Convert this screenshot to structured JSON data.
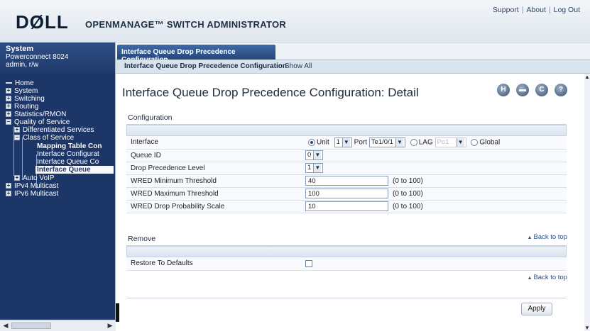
{
  "header": {
    "logo": "DØLL",
    "app_title": "OPENMANAGE™ SWITCH ADMINISTRATOR",
    "links": [
      "Support",
      "About",
      "Log Out"
    ]
  },
  "system_box": {
    "title": "System",
    "model": "Powerconnect 8024",
    "user": "admin, r/w"
  },
  "nav": {
    "home": "Home",
    "system": "System",
    "switching": "Switching",
    "routing": "Routing",
    "statistics": "Statistics/RMON",
    "qos": "Quality of Service",
    "diffserv": "Differentiated Services",
    "cos": "Class of Service",
    "mapping_table": "Mapping Table Con",
    "interface_config": "Interface Configurat",
    "interface_queue_co": "Interface Queue Co",
    "interface_queue_sel": "Interface Queue",
    "auto_voip": "Auto VoIP",
    "ipv4_mc": "IPv4 Multicast",
    "ipv6_mc": "IPv6 Multicast"
  },
  "tabs": {
    "active": "Interface Queue Drop Precedence Configuration",
    "sub1": "Interface Queue Drop Precedence Configuration",
    "sub2": "Show All"
  },
  "page": {
    "title": "Interface Queue Drop Precedence Configuration: Detail",
    "tools": [
      "H",
      "▬",
      "C",
      "?"
    ]
  },
  "configuration": {
    "title": "Configuration",
    "interface_label": "Interface",
    "unit_label": "Unit",
    "unit_value": "1",
    "port_label": "Port",
    "port_value": "Te1/0/1",
    "lag_label": "LAG",
    "lag_value": "Po1",
    "global_label": "Global",
    "queue_label": "Queue ID",
    "queue_value": "0",
    "drop_label": "Drop Precedence Level",
    "drop_value": "1",
    "wmin_label": "WRED Minimum Threshold",
    "wmin_value": "40",
    "wmin_range": "(0 to 100)",
    "wmax_label": "WRED Maximum Threshold",
    "wmax_value": "100",
    "wmax_range": "(0 to 100)",
    "wprob_label": "WRED Drop Probability Scale",
    "wprob_value": "10",
    "wprob_range": "(0 to 100)"
  },
  "remove": {
    "title": "Remove",
    "restore_label": "Restore To Defaults"
  },
  "back_to_top": "Back to top",
  "apply": "Apply"
}
